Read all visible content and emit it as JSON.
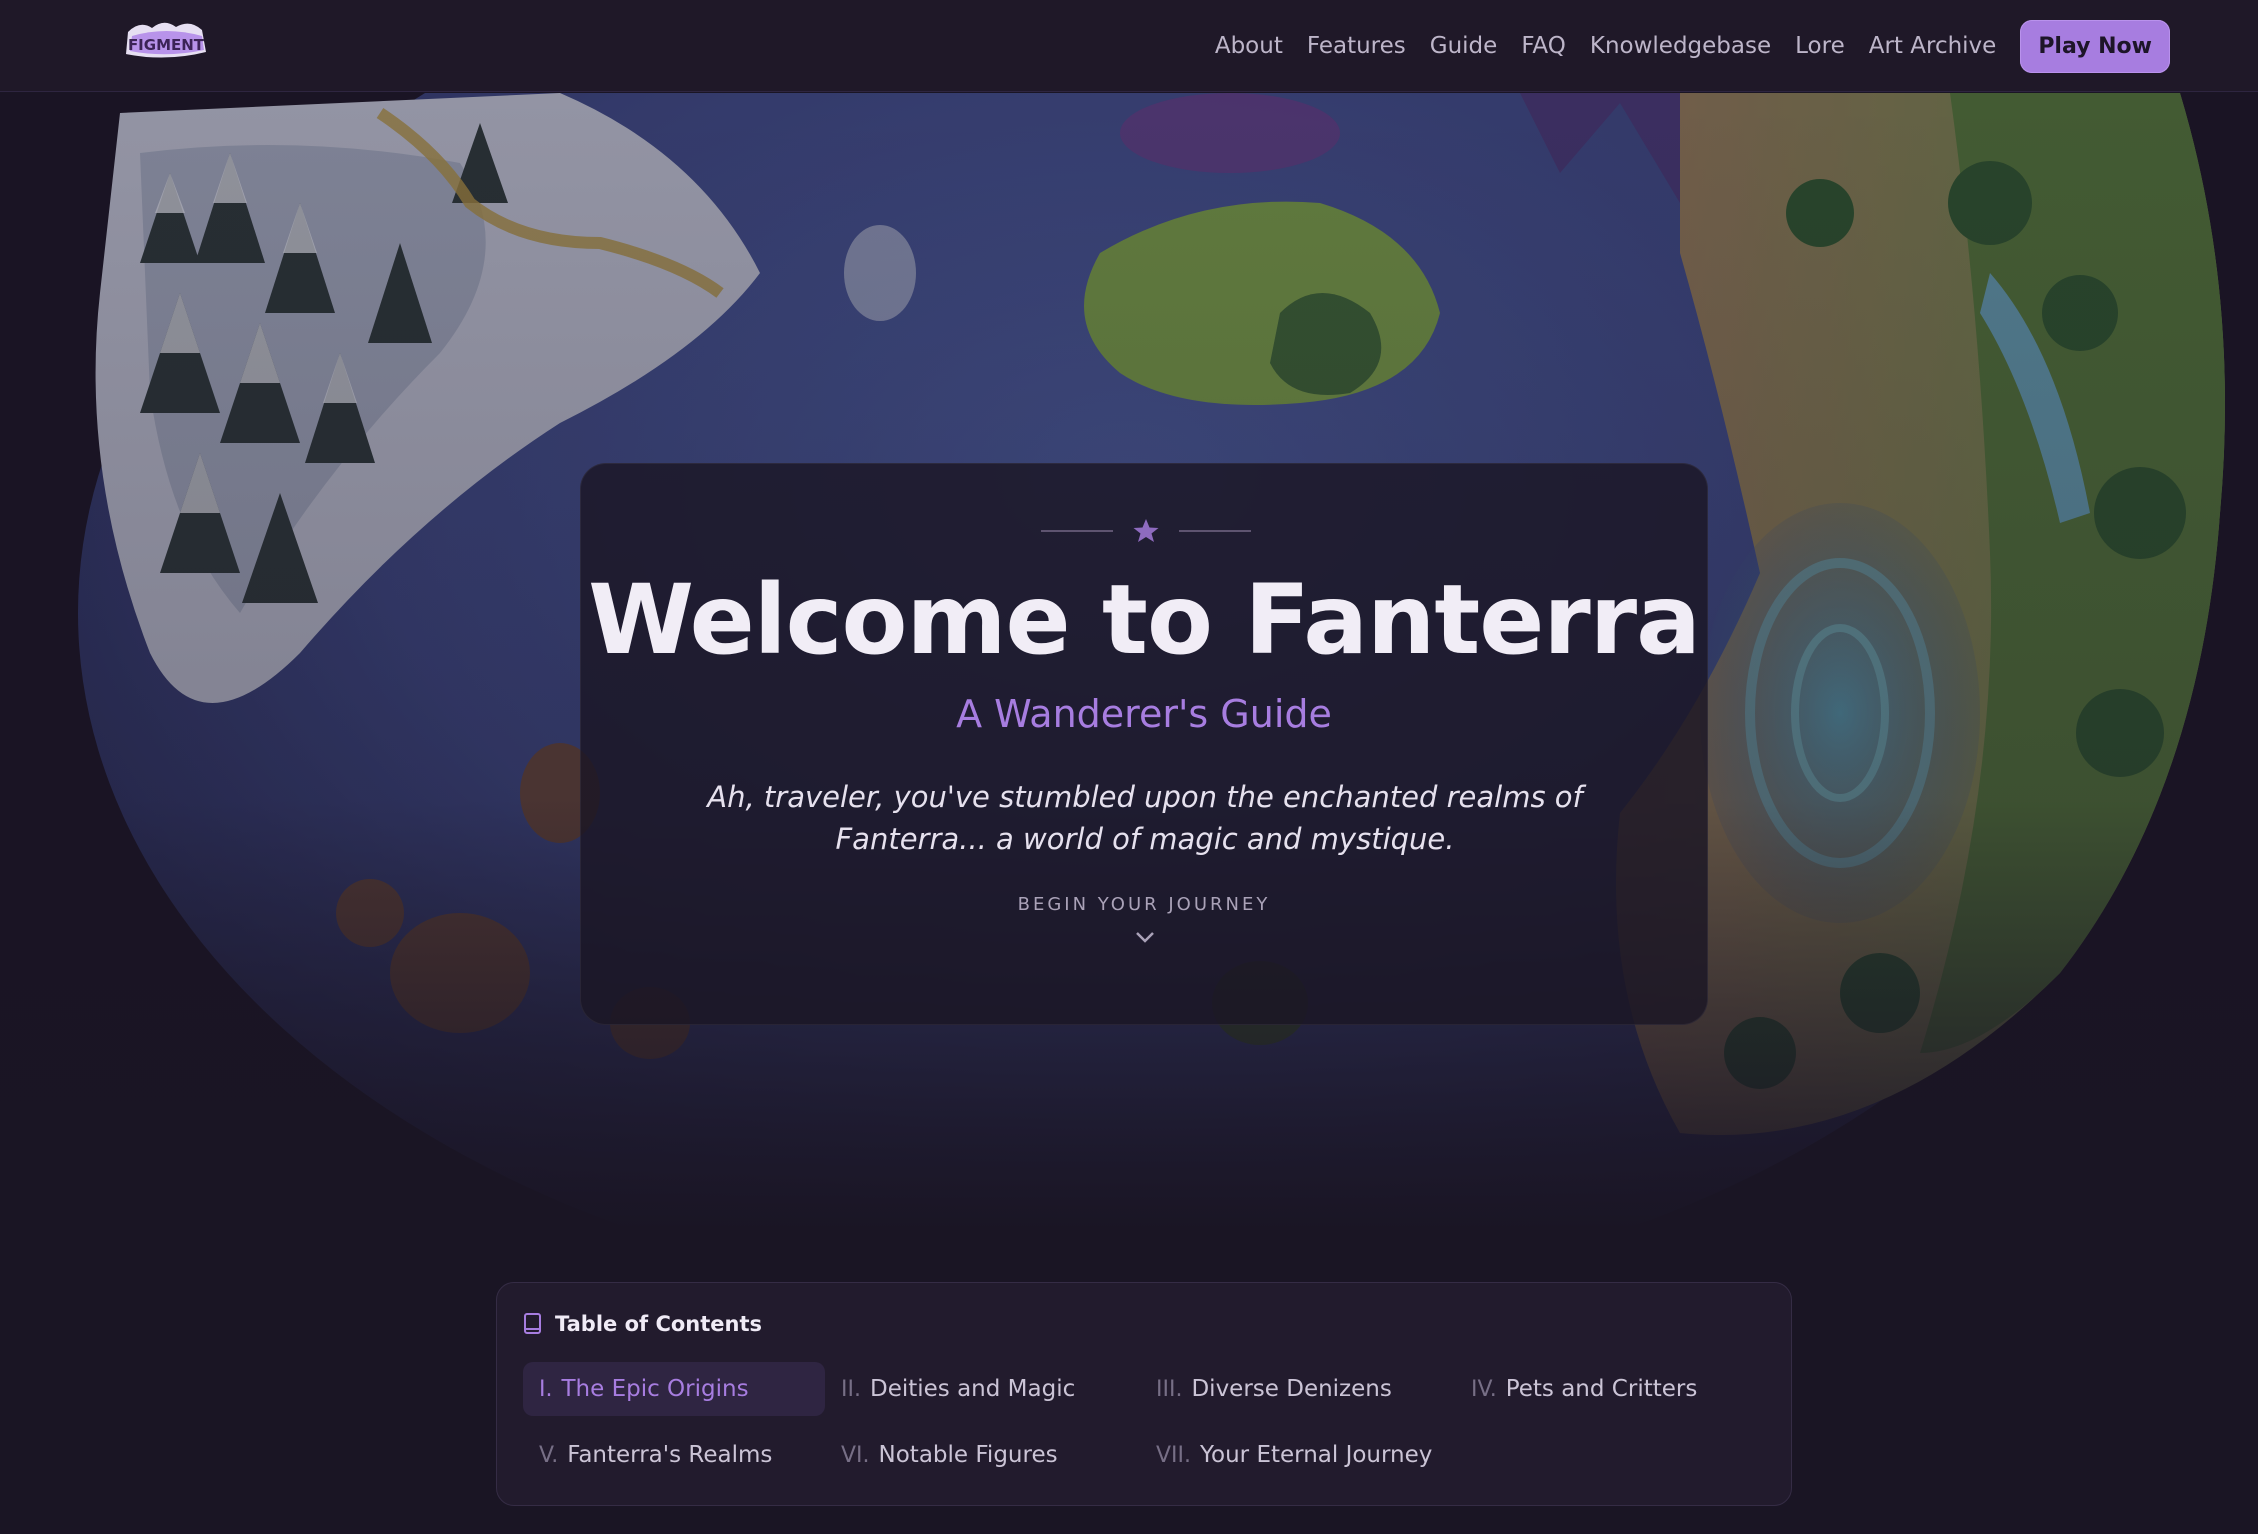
{
  "nav": {
    "logo_text": "FIGMENT",
    "links": [
      "About",
      "Features",
      "Guide",
      "FAQ",
      "Knowledgebase",
      "Lore",
      "Art Archive"
    ],
    "cta": "Play Now"
  },
  "hero": {
    "title": "Welcome to Fanterra",
    "subtitle": "A Wanderer's Guide",
    "intro": "Ah, traveler, you've stumbled upon the enchanted realms of Fanterra... a world of magic and mystique.",
    "begin": "BEGIN YOUR JOURNEY",
    "ornament_icon": "star-icon",
    "scroll_icon": "chevron-down-icon"
  },
  "toc": {
    "title": "Table of Contents",
    "icon": "book-icon",
    "items": [
      {
        "num": "I.",
        "label": "The Epic Origins",
        "active": true
      },
      {
        "num": "II.",
        "label": "Deities and Magic"
      },
      {
        "num": "III.",
        "label": "Diverse Denizens"
      },
      {
        "num": "IV.",
        "label": "Pets and Critters"
      },
      {
        "num": "V.",
        "label": "Fanterra's Realms"
      },
      {
        "num": "VI.",
        "label": "Notable Figures"
      },
      {
        "num": "VII.",
        "label": "Your Eternal Journey"
      }
    ]
  },
  "colors": {
    "accent": "#a77de0",
    "background": "#1a1524",
    "card": "#221b2d"
  }
}
